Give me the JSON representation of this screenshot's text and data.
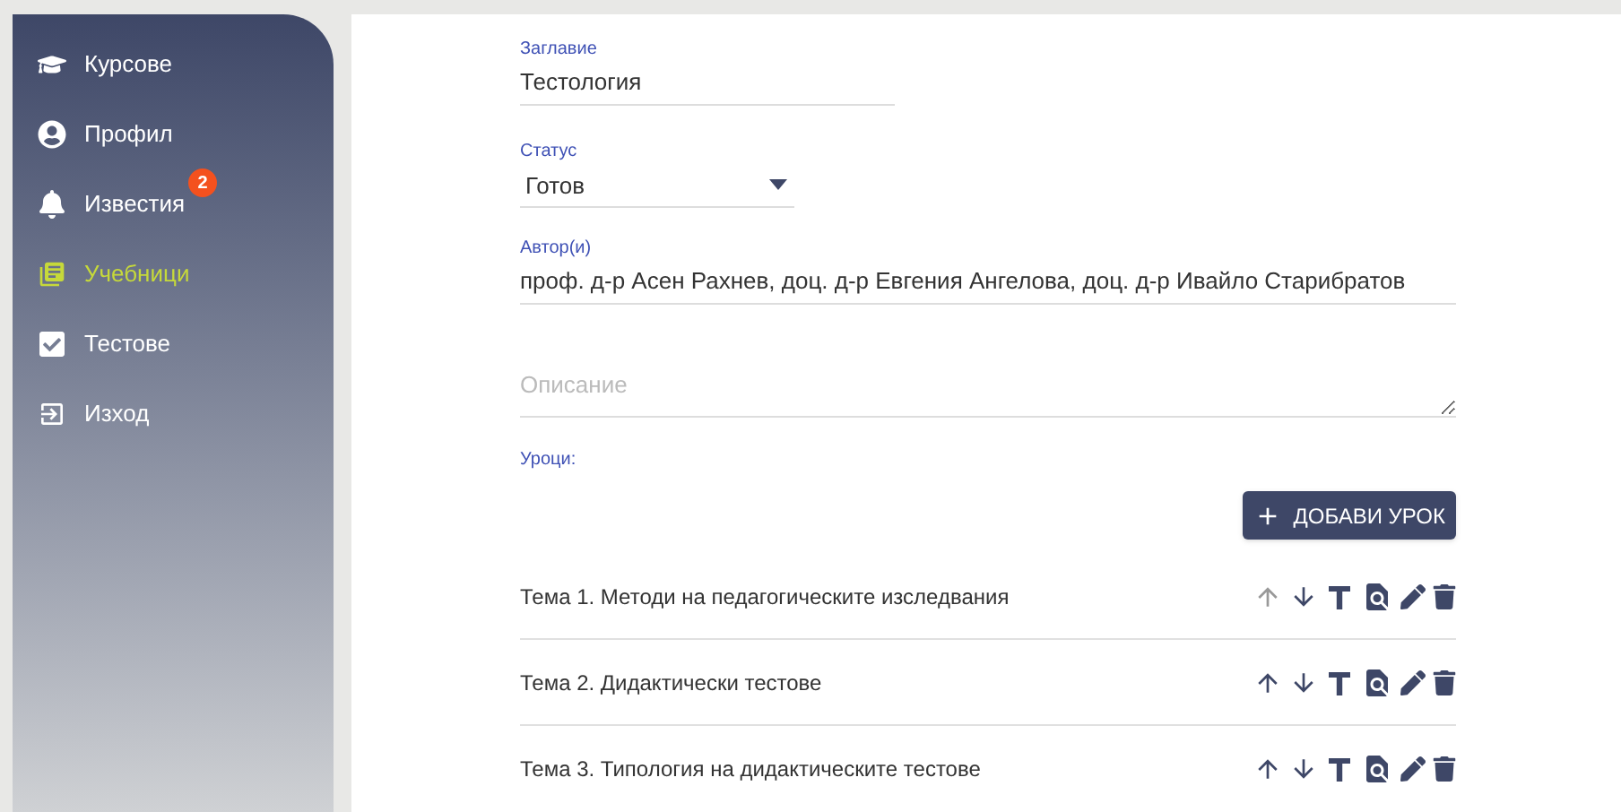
{
  "sidebar": {
    "items": [
      {
        "kind": "courses",
        "label": "Курсове",
        "selected": false
      },
      {
        "kind": "profile",
        "label": "Профил",
        "selected": false
      },
      {
        "kind": "notifications",
        "label": "Известия",
        "selected": false,
        "badge": "2"
      },
      {
        "kind": "textbooks",
        "label": "Учебници",
        "selected": true
      },
      {
        "kind": "tests",
        "label": "Тестове",
        "selected": false
      },
      {
        "kind": "logout",
        "label": "Изход",
        "selected": false
      }
    ]
  },
  "form": {
    "title": {
      "label": "Заглавие",
      "value": "Тестология"
    },
    "status": {
      "label": "Статус",
      "value": "Готов"
    },
    "authors": {
      "label": "Автор(и)",
      "value": "проф. д-р Асен Рахнев, доц. д-р Евгения Ангелова, доц. д-р Ивайло Старибратов"
    },
    "description": {
      "placeholder": "Описание"
    },
    "lessons_label": "Уроци:",
    "add_button": "ДОБАВИ УРОК",
    "lessons": [
      {
        "title": "Тема 1. Методи на педагогическите изследвания",
        "up_disabled": true
      },
      {
        "title": "Тема 2. Дидактически тестове",
        "up_disabled": false
      },
      {
        "title": "Тема 3. Типология на дидактическите тестове",
        "up_disabled": false
      }
    ]
  }
}
